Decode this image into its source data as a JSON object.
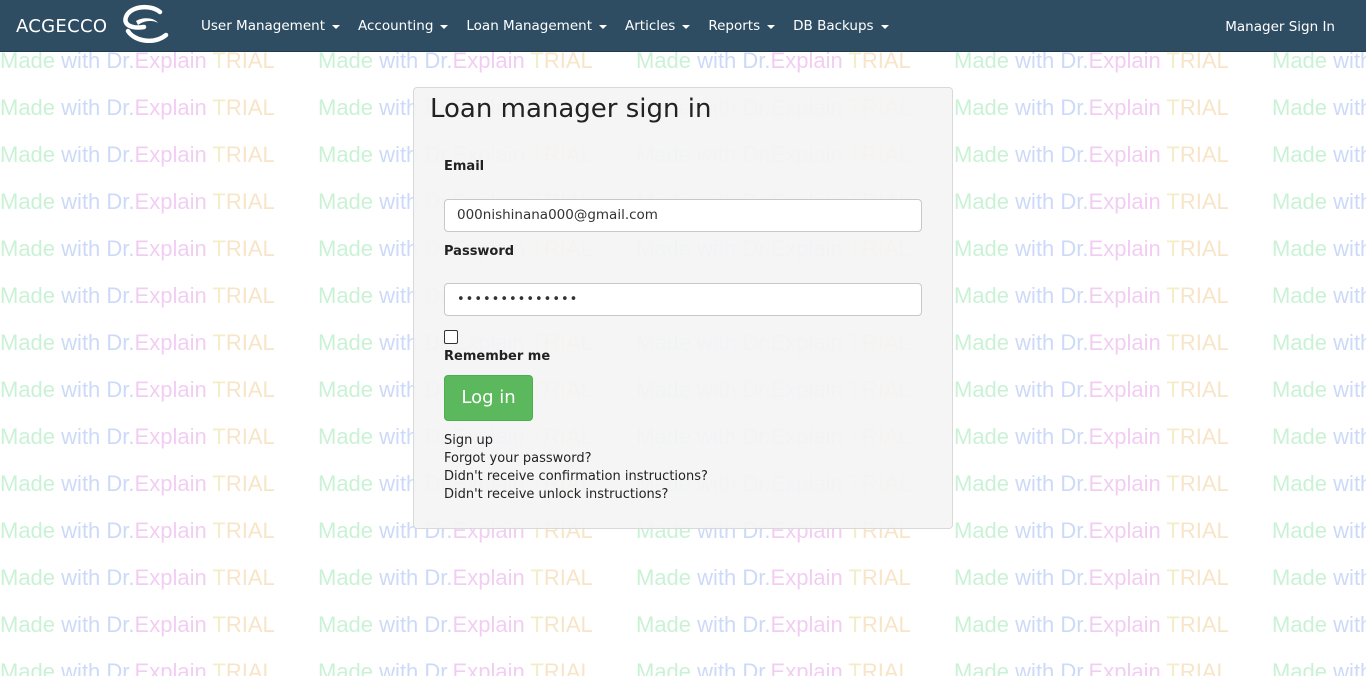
{
  "navbar": {
    "brand": "ACGECCO",
    "items": [
      {
        "label": "User Management"
      },
      {
        "label": "Accounting"
      },
      {
        "label": "Loan Management"
      },
      {
        "label": "Articles"
      },
      {
        "label": "Reports"
      },
      {
        "label": "DB Backups"
      }
    ],
    "sign_in": "Manager Sign In"
  },
  "form": {
    "title": "Loan manager sign in",
    "email_label": "Email",
    "email_value": "000nishinana000@gmail.com",
    "password_label": "Password",
    "password_value": "••••••••••••••",
    "remember_label": "Remember me",
    "login_button": "Log in",
    "links": [
      "Sign up",
      "Forgot your password?",
      "Didn't receive confirmation instructions?",
      "Didn't receive unlock instructions?"
    ]
  },
  "watermark": {
    "w1": "Made",
    "w2": "with",
    "w3": "Dr.",
    "w4": "Explain",
    "w5": "T",
    "w6": "RIAL"
  },
  "colors": {
    "navbar": "#2e4d63",
    "login_button": "#5cb85c"
  }
}
